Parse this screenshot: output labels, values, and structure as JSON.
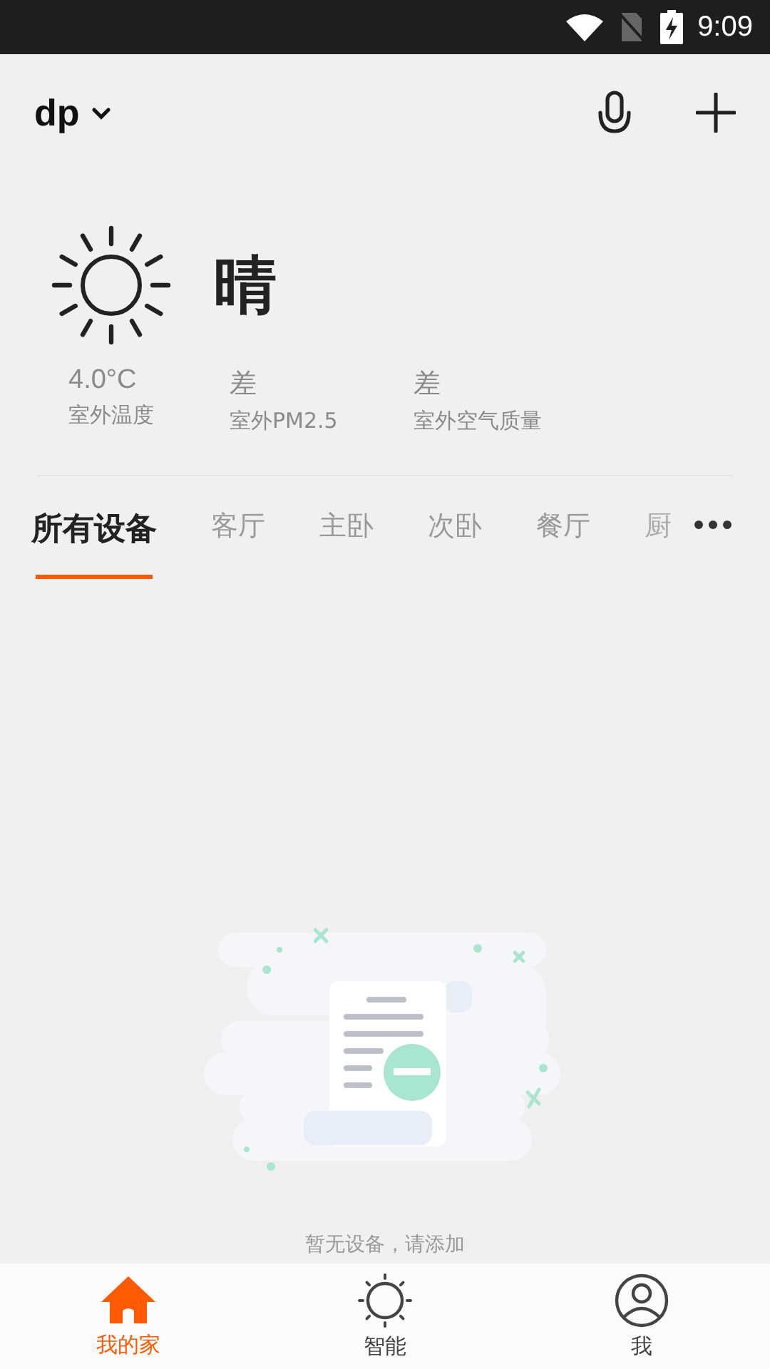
{
  "status_bar": {
    "time": "9:09"
  },
  "header": {
    "home_name": "dp"
  },
  "weather": {
    "condition": "晴",
    "stats": [
      {
        "value": "4.0°C",
        "label": "室外温度"
      },
      {
        "value": "差",
        "label": "室外PM2.5"
      },
      {
        "value": "差",
        "label": "室外空气质量"
      }
    ]
  },
  "tabs": [
    {
      "label": "所有设备",
      "selected": true
    },
    {
      "label": "客厅",
      "selected": false
    },
    {
      "label": "主卧",
      "selected": false
    },
    {
      "label": "次卧",
      "selected": false
    },
    {
      "label": "餐厅",
      "selected": false
    },
    {
      "label": "厨",
      "selected": false
    }
  ],
  "empty_state": {
    "message": "暂无设备，请添加"
  },
  "bottom_nav": [
    {
      "kind": "home",
      "label": "我的家",
      "selected": true
    },
    {
      "kind": "smart",
      "label": "智能",
      "selected": false
    },
    {
      "kind": "me",
      "label": "我",
      "selected": false
    }
  ]
}
